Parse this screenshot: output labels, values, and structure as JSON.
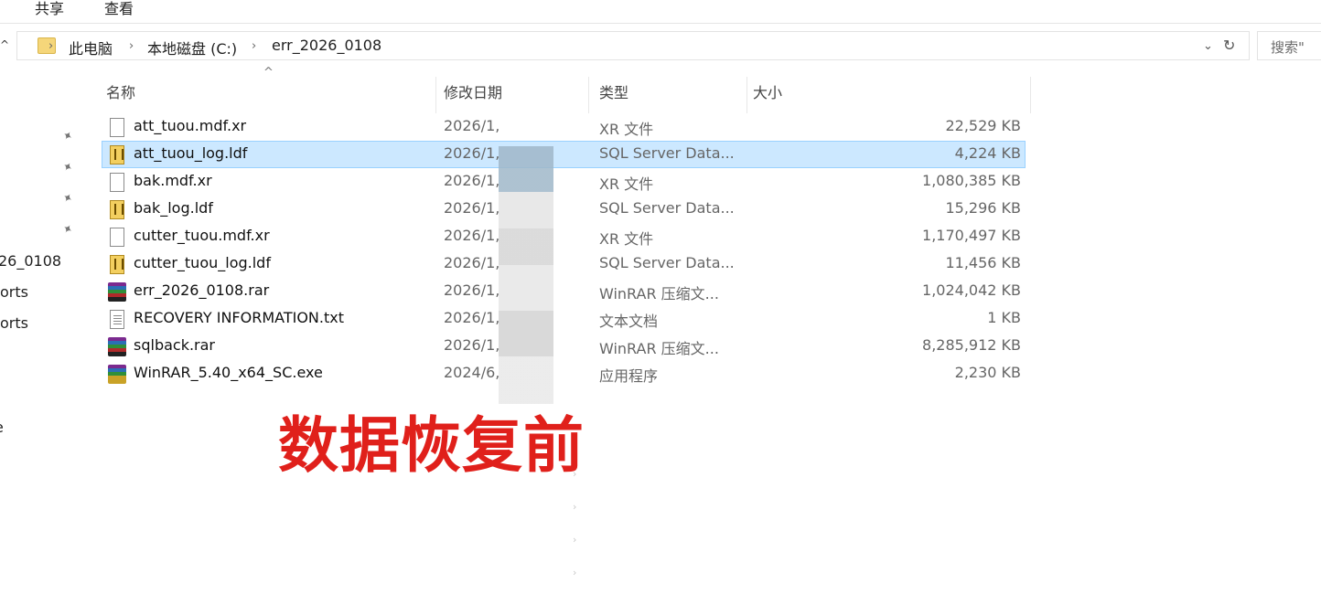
{
  "ribbon": {
    "tabs": [
      "共享",
      "查看"
    ]
  },
  "address": {
    "crumbs": [
      "此电脑",
      "本地磁盘 (C:)",
      "err_2026_0108"
    ],
    "separator": "›",
    "refresh_glyph": "↻",
    "dropdown_glyph": "⌄"
  },
  "search": {
    "placeholder": "搜索\""
  },
  "nav": {
    "items": [
      "26_0108",
      "orts",
      "orts",
      "e"
    ]
  },
  "columns": {
    "name": "名称",
    "date": "修改日期",
    "type": "类型",
    "size": "大小"
  },
  "files": [
    {
      "name": "att_tuou.mdf.xr",
      "date": "2026/1,",
      "type": "XR 文件",
      "size": "22,529 KB",
      "icon": "blank-file-icon"
    },
    {
      "name": "att_tuou_log.ldf",
      "date": "2026/1,",
      "type": "SQL Server Data...",
      "size": "4,224 KB",
      "icon": "sql-ldf-icon",
      "selected": true
    },
    {
      "name": "bak.mdf.xr",
      "date": "2026/1,",
      "type": "XR 文件",
      "size": "1,080,385 KB",
      "icon": "blank-file-icon"
    },
    {
      "name": "bak_log.ldf",
      "date": "2026/1,",
      "type": "SQL Server Data...",
      "size": "15,296 KB",
      "icon": "sql-ldf-icon"
    },
    {
      "name": "cutter_tuou.mdf.xr",
      "date": "2026/1,",
      "type": "XR 文件",
      "size": "1,170,497 KB",
      "icon": "blank-file-icon"
    },
    {
      "name": "cutter_tuou_log.ldf",
      "date": "2026/1,",
      "type": "SQL Server Data...",
      "size": "11,456 KB",
      "icon": "sql-ldf-icon"
    },
    {
      "name": "err_2026_0108.rar",
      "date": "2026/1,",
      "type": "WinRAR 压缩文...",
      "size": "1,024,042 KB",
      "icon": "winrar-archive-icon"
    },
    {
      "name": "RECOVERY INFORMATION.txt",
      "date": "2026/1,",
      "type": "文本文档",
      "size": "1 KB",
      "icon": "text-file-icon"
    },
    {
      "name": "sqlback.rar",
      "date": "2026/1,",
      "type": "WinRAR 压缩文...",
      "size": "8,285,912 KB",
      "icon": "winrar-archive-icon"
    },
    {
      "name": "WinRAR_5.40_x64_SC.exe",
      "date": "2024/6,",
      "type": "应用程序",
      "size": "2,230 KB",
      "icon": "winrar-installer-icon"
    }
  ],
  "caption": "数据恢复前",
  "colors": {
    "selection": "#cce8ff",
    "caption": "#e0201b"
  }
}
